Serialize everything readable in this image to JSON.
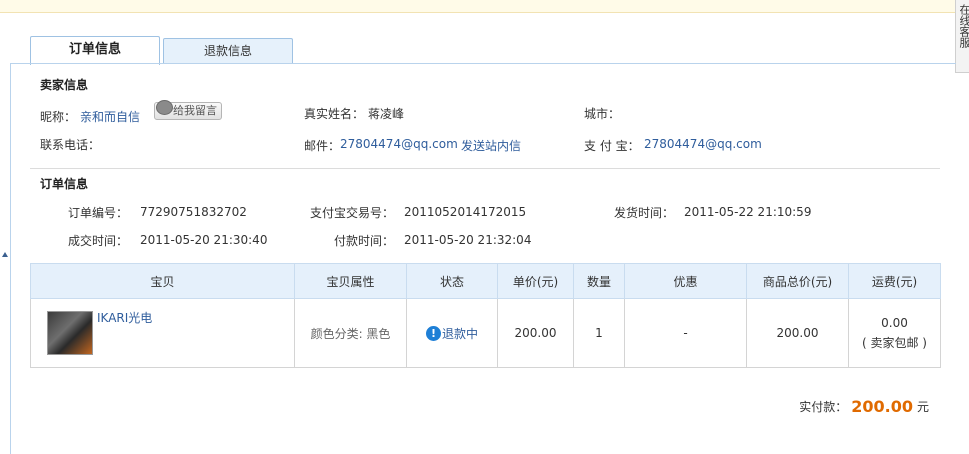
{
  "tabs": [
    {
      "label": "订单信息",
      "active": true
    },
    {
      "label": "退款信息",
      "active": false
    }
  ],
  "right_strip_text": "在线客服",
  "seller": {
    "section_title": "卖家信息",
    "nickname_label": "昵称：",
    "nickname": "亲和而自信",
    "message_button": "给我留言",
    "realname_label": "真实姓名：",
    "realname": "蒋凌峰",
    "city_label": "城市：",
    "city": "",
    "phone_label": "联系电话：",
    "phone": "",
    "email_label": "邮件：",
    "email": "27804474@qq.com",
    "send_message": "发送站内信",
    "alipay_label": "支 付 宝：",
    "alipay": "27804474@qq.com"
  },
  "order": {
    "section_title": "订单信息",
    "order_no_label": "订单编号：",
    "order_no": "77290751832702",
    "alipay_trade_label": "支付宝交易号：",
    "alipay_trade_no": "2011052014172015",
    "ship_time_label": "发货时间：",
    "ship_time": "2011-05-22 21:10:59",
    "deal_time_label": "成交时间：",
    "deal_time": "2011-05-20 21:30:40",
    "pay_time_label": "付款时间：",
    "pay_time": "2011-05-20 21:32:04"
  },
  "goods_table": {
    "headers": [
      "宝贝",
      "宝贝属性",
      "状态",
      "单价(元)",
      "数量",
      "优惠",
      "商品总价(元)",
      "运费(元)"
    ],
    "rows": [
      {
        "name": "IKARI光电",
        "attribute": "颜色分类: 黑色",
        "status": "退款中",
        "unit_price": "200.00",
        "quantity": "1",
        "discount": "-",
        "total": "200.00",
        "shipping": "0.00",
        "shipping_note": "( 卖家包邮 )"
      }
    ]
  },
  "summary": {
    "label": "实付款：",
    "amount": "200.00",
    "unit": "元"
  },
  "colors": {
    "link": "#2f5d9c",
    "accent_orange": "#e06a00",
    "table_header_bg": "#e5f0fb",
    "tab_border": "#9fc2e3"
  }
}
